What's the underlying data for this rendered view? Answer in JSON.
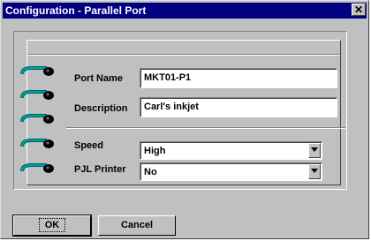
{
  "window": {
    "title": "Configuration - Parallel Port",
    "close_glyph": "✕"
  },
  "form": {
    "port_name": {
      "label": "Port Name",
      "value": "MKT01-P1"
    },
    "description": {
      "label": "Description",
      "value": "Carl's inkjet"
    },
    "speed": {
      "label": "Speed",
      "value": "High"
    },
    "pjl_printer": {
      "label": "PJL Printer",
      "value": "No"
    }
  },
  "buttons": {
    "ok": "OK",
    "cancel": "Cancel"
  },
  "icons": [
    "close-icon",
    "spiral-ring-icon",
    "dropdown-arrow-icon"
  ],
  "colors": {
    "title_bar": "#000080",
    "face": "#c0c0c0",
    "ring": "#008080"
  }
}
